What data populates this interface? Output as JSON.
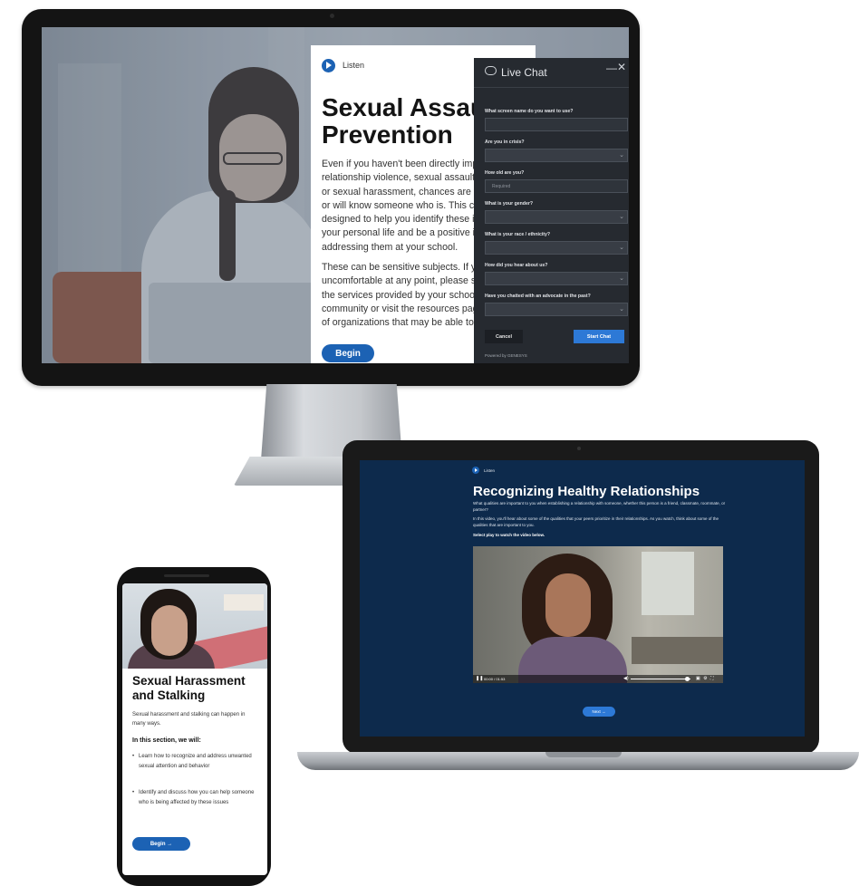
{
  "desktop": {
    "listen_label": "Listen",
    "title": "Sexual Assault Prevention",
    "paragraph1": "Even if you haven't been directly impacted by\nrelationship violence, sexual assault, stalking,\nor sexual harassment, chances are you know\nor will know someone who is. This course is\ndesigned to help you identify these issues in\nyour personal life and be a positive influence\naddressing them at your school.",
    "paragraph2": "These can be sensitive subjects. If you feel\nuncomfortable at any point, please seek\nthe services provided by your school or\ncommunity or visit the resources page for a list\nof organizations that may be able to help.",
    "begin_label": "Begin"
  },
  "live_chat": {
    "title": "Live Chat",
    "minimize_glyph": "—",
    "close_glyph": "✕",
    "fields": [
      {
        "label": "What screen name do you want to use?",
        "type": "text",
        "placeholder": ""
      },
      {
        "label": "Are you in crisis?",
        "type": "select",
        "placeholder": ""
      },
      {
        "label": "How old are you?",
        "type": "text",
        "placeholder": "Required"
      },
      {
        "label": "What is your gender?",
        "type": "select",
        "placeholder": ""
      },
      {
        "label": "What is your race / ethnicity?",
        "type": "select",
        "placeholder": ""
      },
      {
        "label": "How did you hear about us?",
        "type": "select",
        "placeholder": ""
      },
      {
        "label": "Have you chatted with an advocate in the past?",
        "type": "select",
        "placeholder": ""
      }
    ],
    "cancel_label": "Cancel",
    "start_label": "Start Chat",
    "powered_by": "Powered by GENESYS"
  },
  "laptop": {
    "listen_label": "Listen",
    "title": "Recognizing Healthy Relationships",
    "p1": "What qualities are important to you when establishing a relationship with someone, whether this person is a friend, classmate, roommate, or partner?",
    "p2": "In this video, you'll hear about some of the qualities that your peers prioritize in their relationships. As you watch, think about some of the qualities that are important to you.",
    "p3": "Select play to watch the video below.",
    "video_time": "00:00 / 01:53",
    "video_progress": 0.0,
    "video_volume": 0.95,
    "next_label": "Next →"
  },
  "phone": {
    "title": "Sexual Harassment and Stalking",
    "intro": "Sexual harassment and stalking can happen in many ways.",
    "section_heading": "In this section, we will:",
    "bullets": [
      "Learn how to recognize and address unwanted sexual attention and behavior",
      "Identify and discuss how you can help someone who is being affected by these issues"
    ],
    "begin_label": "Begin →"
  },
  "colors": {
    "accent_blue": "#1c62b4",
    "chat_button_blue": "#2d79d6",
    "laptop_background": "#0d2a4c",
    "chat_background": "#262a30"
  },
  "icons": [
    "listen-play-icon",
    "chat-bubble-icon",
    "minimize-icon",
    "close-icon",
    "chevron-down-icon",
    "play-icon",
    "volume-icon",
    "fullscreen-icon"
  ]
}
